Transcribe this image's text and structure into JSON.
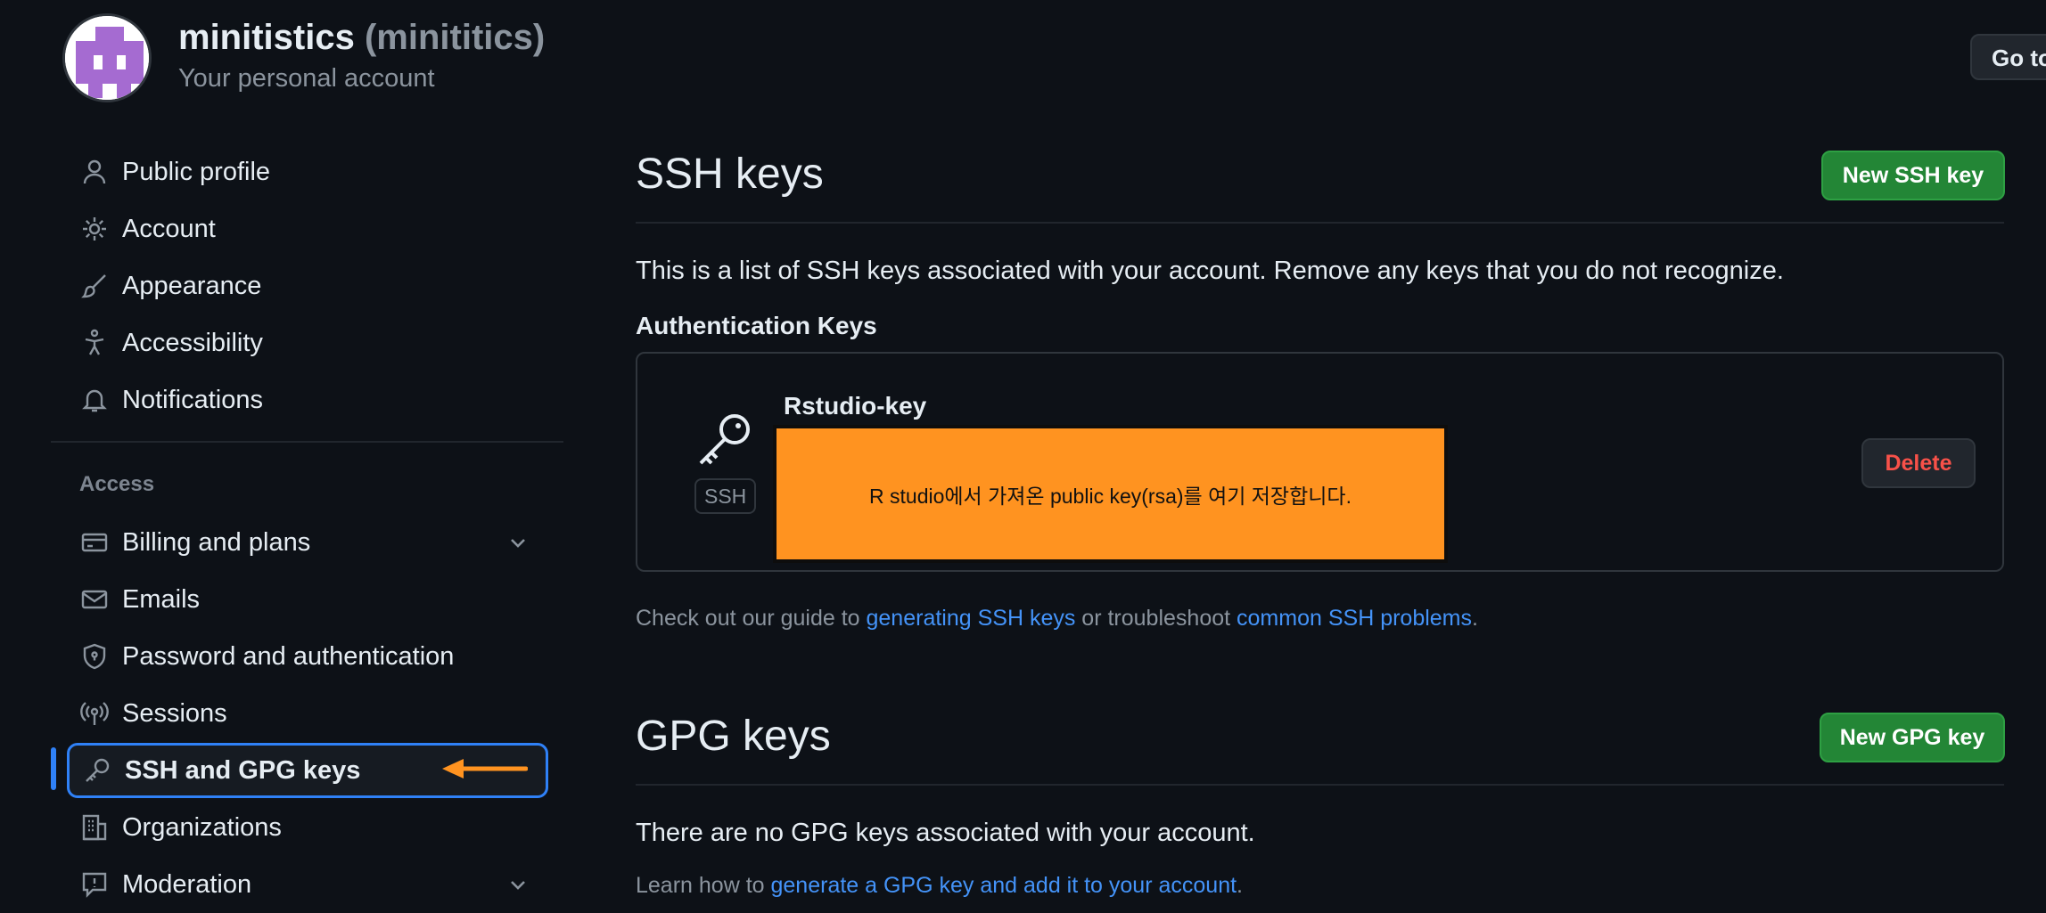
{
  "header": {
    "account_name": "minitistics",
    "account_login": "(minititics)",
    "subtitle": "Your personal account",
    "goto_button": "Go to"
  },
  "sidebar": {
    "items": [
      {
        "label": "Public profile",
        "icon": "person-icon"
      },
      {
        "label": "Account",
        "icon": "gear-icon"
      },
      {
        "label": "Appearance",
        "icon": "paintbrush-icon"
      },
      {
        "label": "Accessibility",
        "icon": "accessibility-icon"
      },
      {
        "label": "Notifications",
        "icon": "bell-icon"
      }
    ],
    "access_label": "Access",
    "access_items": [
      {
        "label": "Billing and plans",
        "icon": "credit-card-icon",
        "expandable": true
      },
      {
        "label": "Emails",
        "icon": "mail-icon"
      },
      {
        "label": "Password and authentication",
        "icon": "shield-lock-icon"
      },
      {
        "label": "Sessions",
        "icon": "broadcast-icon"
      },
      {
        "label": "SSH and GPG keys",
        "icon": "key-icon",
        "selected": true
      },
      {
        "label": "Organizations",
        "icon": "organization-icon"
      },
      {
        "label": "Moderation",
        "icon": "report-icon",
        "expandable": true
      }
    ]
  },
  "ssh": {
    "title": "SSH keys",
    "new_button": "New SSH key",
    "description": "This is a list of SSH keys associated with your account. Remove any keys that you do not recognize.",
    "auth_heading": "Authentication Keys",
    "key": {
      "name": "Rstudio-key",
      "badge": "SSH",
      "overlay_note": "R studio에서 가져온 public key(rsa)를 여기 저장합니다.",
      "delete_button": "Delete"
    },
    "guide": {
      "prefix": "Check out our guide to ",
      "link1": "generating SSH keys",
      "middle": " or troubleshoot ",
      "link2": "common SSH problems",
      "suffix": "."
    }
  },
  "gpg": {
    "title": "GPG keys",
    "new_button": "New GPG key",
    "empty_text": "There are no GPG keys associated with your account.",
    "learn": {
      "prefix": "Learn how to ",
      "link": "generate a GPG key and add it to your account",
      "suffix": "."
    }
  },
  "colors": {
    "background": "#0d1117",
    "accent_blue": "#2f81f7",
    "green_button": "#238636",
    "overlay_orange": "#ff9320",
    "danger": "#f85149"
  }
}
